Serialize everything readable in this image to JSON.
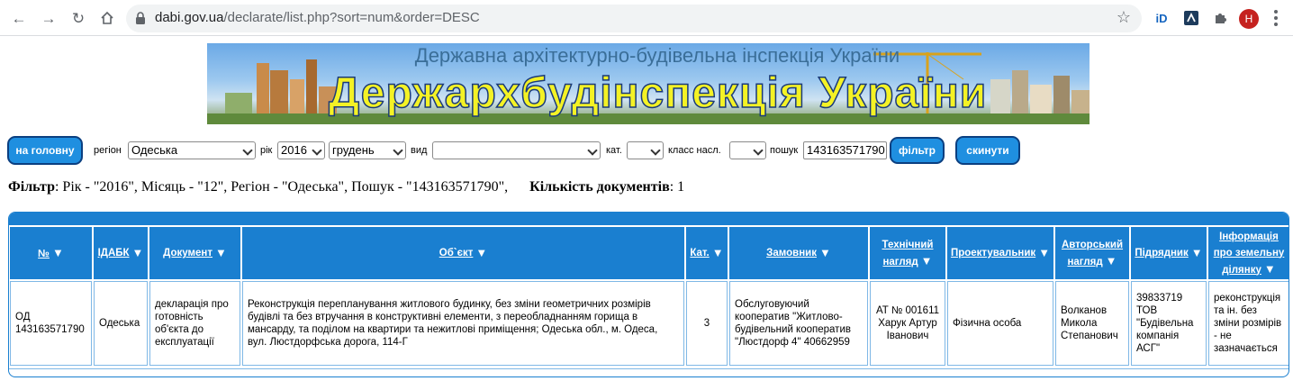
{
  "browser": {
    "url_host": "dabi.gov.ua",
    "url_path": "/declarate/list.php?sort=num&order=DESC",
    "profile_initial": "H"
  },
  "banner": {
    "subtitle": "Державна архітектурно-будівельна інспекція України",
    "title": "Держархбудінспекція України"
  },
  "toolbar": {
    "home_button": "на головну",
    "region_label": "регіон",
    "region_value": "Одеська",
    "year_label": "рік",
    "year_value": "2016",
    "month_value": "грудень",
    "kind_label": "вид",
    "kind_value": "",
    "category_label": "кат.",
    "category_value": "",
    "class_label": "класс насл.",
    "class_value": "",
    "search_label": "пошук",
    "search_value": "143163571790",
    "filter_button": "фільтр",
    "reset_button": "скинути"
  },
  "filter_summary": {
    "filter_label": "Фільтр",
    "filter_text": ": Рік - \"2016\", Місяць - \"12\", Регіон - \"Одеська\", Пошук - \"143163571790\",",
    "count_label": "Кількість документів",
    "count_text": ": 1"
  },
  "table": {
    "headers": {
      "num": "№",
      "idabk": "ІДАБК",
      "document": "Документ",
      "object": "Об`єкт",
      "category": "Кат.",
      "customer": "Замовник",
      "tech_supervision": "Технічний нагляд",
      "designer": "Проектувальник",
      "author_supervision": "Авторський нагляд",
      "contractor": "Підрядник",
      "land_info": "Інформація про земельну ділянку"
    },
    "sort_arrow": "▼",
    "rows": [
      {
        "num": "ОД 143163571790",
        "idabk": "Одеська",
        "document": "декларація про готовність об'єкта до експлуатації",
        "object": "Реконструкція перепланування житлового будинку, без зміни геометричних розмірів будівлі та без втручання в конструктивні елементи, з переобладнанням горища в мансарду, та поділом на квартири та нежитлові приміщення; Одеська обл., м. Одеса, вул. Люстдорфська дорога, 114-Г",
        "category": "3",
        "customer": "Обслуговуючий кооператив \"Житлово-будівельний кооператив \"Люстдорф 4\" 40662959",
        "tech_supervision": "АТ № 001611 Харук Артур Іванович",
        "designer": "Фізична особа",
        "author_supervision": "Волканов Микола Степанович",
        "contractor": "39833719 ТОВ \"Будівельна компанія АСГ\"",
        "land_info": "реконструкція та ін. без зміни розмірів - не зазначається"
      }
    ]
  }
}
